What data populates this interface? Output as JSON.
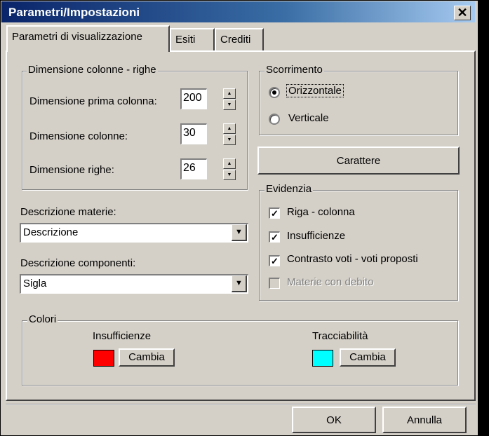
{
  "window": {
    "title": "Parametri/Impostazioni",
    "close_glyph": "✕"
  },
  "tabs": [
    {
      "label": "Parametri di visualizzazione",
      "active": true
    },
    {
      "label": "Esiti",
      "active": false
    },
    {
      "label": "Crediti",
      "active": false
    }
  ],
  "dimensions": {
    "legend": "Dimensione colonne - righe",
    "first_column_label": "Dimensione prima colonna:",
    "first_column_value": "200",
    "columns_label": "Dimensione colonne:",
    "columns_value": "30",
    "rows_label": "Dimensione righe:",
    "rows_value": "26"
  },
  "scrolling": {
    "legend": "Scorrimento",
    "horizontal_label": "Orizzontale",
    "vertical_label": "Verticale",
    "selected": "Orizzontale"
  },
  "font_button_label": "Carattere",
  "subjects": {
    "label": "Descrizione materie:",
    "selected": "Descrizione"
  },
  "components": {
    "label": "Descrizione componenti:",
    "selected": "Sigla"
  },
  "highlight": {
    "legend": "Evidenzia",
    "items": [
      {
        "label": "Riga - colonna",
        "checked": true,
        "enabled": true
      },
      {
        "label": "Insufficienze",
        "checked": true,
        "enabled": true
      },
      {
        "label": "Contrasto voti - voti proposti",
        "checked": true,
        "enabled": true
      },
      {
        "label": "Materie con debito",
        "checked": false,
        "enabled": false
      }
    ]
  },
  "colors": {
    "legend": "Colori",
    "insufficient": {
      "label": "Insufficienze",
      "color": "#ff0000",
      "button": "Cambia"
    },
    "traceability": {
      "label": "Tracciabilità",
      "color": "#00ffff",
      "button": "Cambia"
    }
  },
  "footer": {
    "ok_label": "OK",
    "cancel_label": "Annulla"
  }
}
